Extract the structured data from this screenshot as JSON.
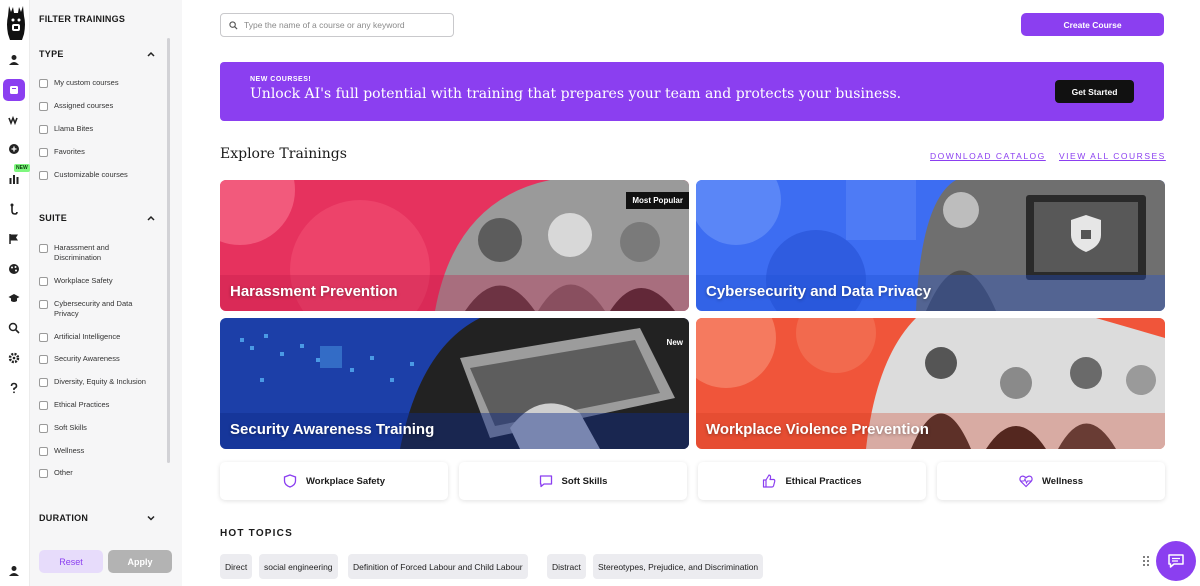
{
  "rail": {
    "new_badge": "NEW",
    "icons": [
      "user-icon",
      "courses-icon",
      "llama-bites-icon",
      "add-icon",
      "reports-icon",
      "learning-path-icon",
      "flag-icon",
      "palette-icon",
      "graduation-icon",
      "search-icon",
      "settings-icon",
      "help-icon"
    ]
  },
  "filter": {
    "title": "FILTER TRAININGS",
    "type": {
      "heading": "TYPE",
      "items": [
        "My custom courses",
        "Assigned courses",
        "Llama Bites",
        "Favorites",
        "Customizable courses"
      ]
    },
    "suite": {
      "heading": "SUITE",
      "items": [
        "Harassment and Discrimination",
        "Workplace Safety",
        "Cybersecurity and Data Privacy",
        "Artificial Intelligence",
        "Security Awareness",
        "Diversity, Equity & Inclusion",
        "Ethical Practices",
        "Soft Skills",
        "Wellness",
        "Other"
      ]
    },
    "duration": {
      "heading": "DURATION"
    },
    "reset_label": "Reset",
    "apply_label": "Apply"
  },
  "search": {
    "placeholder": "Type the name of a course or any keyword"
  },
  "create_course_label": "Create Course",
  "banner": {
    "kicker": "NEW COURSES!",
    "text": "Unlock AI's full potential with training that prepares your team and protects your business.",
    "cta": "Get Started"
  },
  "explore": {
    "title": "Explore Trainings",
    "download_label": "DOWNLOAD CATALOG",
    "view_all_label": "VIEW ALL COURSES"
  },
  "cards": [
    {
      "title": "Harassment Prevention",
      "badge": "Most Popular"
    },
    {
      "title": "Cybersecurity and Data Privacy",
      "badge": ""
    },
    {
      "title": "Security Awareness Training",
      "badge": "New"
    },
    {
      "title": "Workplace Violence Prevention",
      "badge": ""
    }
  ],
  "categories": [
    {
      "label": "Workplace Safety",
      "icon": "shield-icon"
    },
    {
      "label": "Soft Skills",
      "icon": "chat-bubble-icon"
    },
    {
      "label": "Ethical Practices",
      "icon": "thumbs-up-icon"
    },
    {
      "label": "Wellness",
      "icon": "heart-pulse-icon"
    }
  ],
  "hot_topics": {
    "title": "HOT TOPICS",
    "tags": [
      "Direct",
      "social engineering",
      "Definition of Forced Labour and Child Labour",
      "Distract",
      "Stereotypes, Prejudice, and Discrimination"
    ]
  },
  "colors": {
    "accent": "#8b3ff0",
    "dark": "#111111"
  }
}
